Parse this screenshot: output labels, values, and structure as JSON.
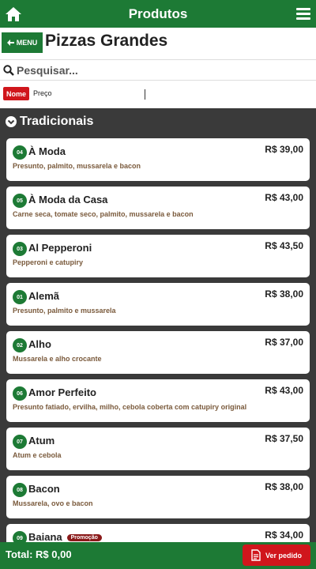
{
  "topbar": {
    "title": "Produtos"
  },
  "header": {
    "back_label": "MENU",
    "title": "Pizzas Grandes"
  },
  "search": {
    "placeholder": "Pesquisar..."
  },
  "sort": {
    "nome": "Nome",
    "preco": "Preço"
  },
  "section": {
    "title": "Tradicionais"
  },
  "items": [
    {
      "code": "04",
      "name": "À Moda",
      "price": "R$ 39,00",
      "desc": "Presunto, palmito, mussarela e bacon"
    },
    {
      "code": "05",
      "name": "À Moda da Casa",
      "price": "R$ 43,00",
      "desc": "Carne seca, tomate seco, palmito, mussarela e bacon"
    },
    {
      "code": "03",
      "name": "Al Pepperoni",
      "price": "R$ 43,50",
      "desc": "Pepperoni e catupiry"
    },
    {
      "code": "01",
      "name": "Alemã",
      "price": "R$ 38,00",
      "desc": "Presunto, palmito e mussarela"
    },
    {
      "code": "02",
      "name": "Alho",
      "price": "R$ 37,00",
      "desc": "Mussarela e alho crocante"
    },
    {
      "code": "06",
      "name": "Amor Perfeito",
      "price": "R$ 43,00",
      "desc": "Presunto fatiado, ervilha, milho, cebola coberta com catupiry original"
    },
    {
      "code": "07",
      "name": "Atum",
      "price": "R$ 37,50",
      "desc": "Atum e cebola"
    },
    {
      "code": "08",
      "name": "Bacon",
      "price": "R$ 38,00",
      "desc": "Mussarela, ovo e bacon"
    },
    {
      "code": "09",
      "name": "Baiana",
      "price": "R$ 34,00",
      "desc": "",
      "badge": "Promoção"
    }
  ],
  "footer": {
    "total": "Total: R$ 0,00",
    "order_label": "Ver pedido"
  }
}
